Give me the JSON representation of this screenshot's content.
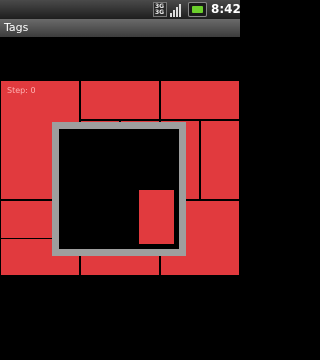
{
  "status_bar": {
    "network_type_top": "3G",
    "network_type_bottom": "3G",
    "time": "8:42",
    "icons": [
      "network-type-icon",
      "signal-strength-icon",
      "battery-icon"
    ]
  },
  "title_bar": {
    "title": "Tags"
  },
  "game": {
    "step_label": "Step: 0",
    "colors": {
      "tile": "#e13a3e",
      "frame": "#9e9e9e",
      "background": "#000000"
    }
  }
}
